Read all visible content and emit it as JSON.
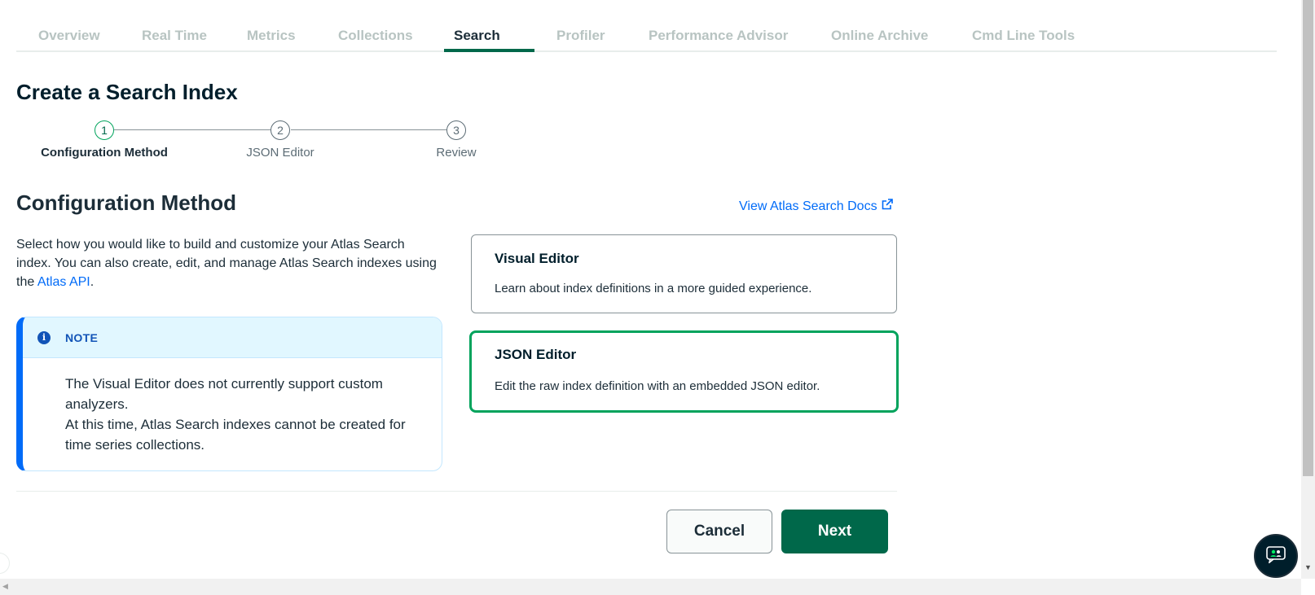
{
  "tabs": [
    {
      "label": "Overview"
    },
    {
      "label": "Real Time"
    },
    {
      "label": "Metrics"
    },
    {
      "label": "Collections"
    },
    {
      "label": "Search"
    },
    {
      "label": "Profiler"
    },
    {
      "label": "Performance Advisor"
    },
    {
      "label": "Online Archive"
    },
    {
      "label": "Cmd Line Tools"
    }
  ],
  "active_tab": "Search",
  "page": {
    "title": "Create a Search Index"
  },
  "stepper": {
    "steps": [
      {
        "number": "1",
        "label": "Configuration Method"
      },
      {
        "number": "2",
        "label": "JSON Editor"
      },
      {
        "number": "3",
        "label": "Review"
      }
    ],
    "current_step": 1
  },
  "section": {
    "title": "Configuration Method",
    "docs_link": "View Atlas Search Docs",
    "description_text": "Select how you would like to build and customize your Atlas Search index. You can also create, edit, and manage Atlas Search indexes using the ",
    "description_link": "Atlas API",
    "description_end": "."
  },
  "note": {
    "title": "NOTE",
    "line1": "The Visual Editor does not currently support custom analyzers.",
    "line2": "At this time, Atlas Search indexes cannot be created for time series collections."
  },
  "options": {
    "visual": {
      "title": "Visual Editor",
      "description": "Learn about index definitions in a more guided experience."
    },
    "json": {
      "title": "JSON Editor",
      "description": "Edit the raw index definition with an embedded JSON editor.",
      "selected": true
    }
  },
  "footer": {
    "cancel_label": "Cancel",
    "next_label": "Next"
  },
  "colors": {
    "brand_green": "#00684a",
    "accent_green": "#00a35c",
    "link_blue": "#016bf8"
  },
  "icons": {
    "note": "info-icon",
    "docs": "external-link-icon",
    "chat": "chat-support-icon"
  }
}
